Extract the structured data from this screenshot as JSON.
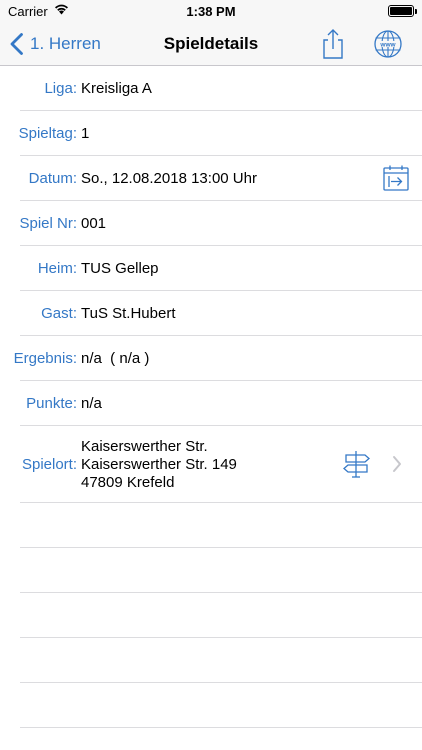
{
  "status_bar": {
    "carrier": "Carrier",
    "time": "1:38 PM"
  },
  "nav": {
    "back_label": "1. Herren",
    "title": "Spieldetails"
  },
  "details": [
    {
      "label": "Liga:",
      "value": "Kreisliga A"
    },
    {
      "label": "Spieltag:",
      "value": "1"
    },
    {
      "label": "Datum:",
      "value": "So., 12.08.2018 13:00 Uhr"
    },
    {
      "label": "Spiel Nr:",
      "value": "001"
    },
    {
      "label": "Heim:",
      "value": "TUS Gellep"
    },
    {
      "label": "Gast:",
      "value": "TuS St.Hubert"
    },
    {
      "label": "Ergebnis:",
      "value": "n/a  ( n/a )"
    },
    {
      "label": "Punkte:",
      "value": "n/a"
    }
  ],
  "spielort": {
    "label": "Spielort:",
    "line1": "Kaiserswerther Str.",
    "line2": "Kaiserswerther Str. 149",
    "line3": "47809 Krefeld"
  },
  "icons": {
    "share": "share-icon",
    "web": "globe-www-icon",
    "calendar": "calendar-add-icon",
    "directions": "signpost-icon",
    "disclosure": "chevron-right-icon"
  },
  "colors": {
    "accent": "#3478c6",
    "separator": "#dcdcdf",
    "bar": "#f7f7f7"
  }
}
